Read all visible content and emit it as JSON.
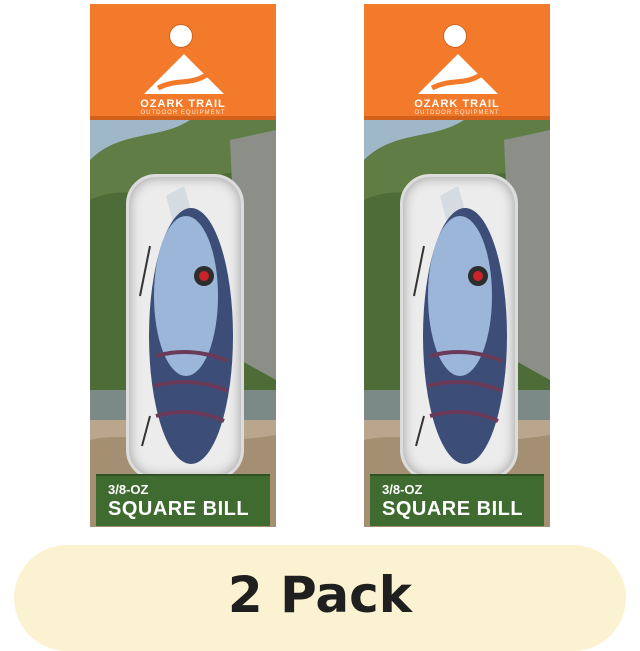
{
  "product": {
    "brand": "OZARK TRAIL",
    "brand_sub": "OUTDOOR EQUIPMENT",
    "weight": "3/8-OZ",
    "name": "SQUARE BILL"
  },
  "badge": {
    "text": "2 Pack"
  },
  "colors": {
    "header": "#f37a2a",
    "label_band": "#3f6b31",
    "banner": "#fbf2d1"
  },
  "icons": [
    "ozark-trail-mountain-logo"
  ]
}
